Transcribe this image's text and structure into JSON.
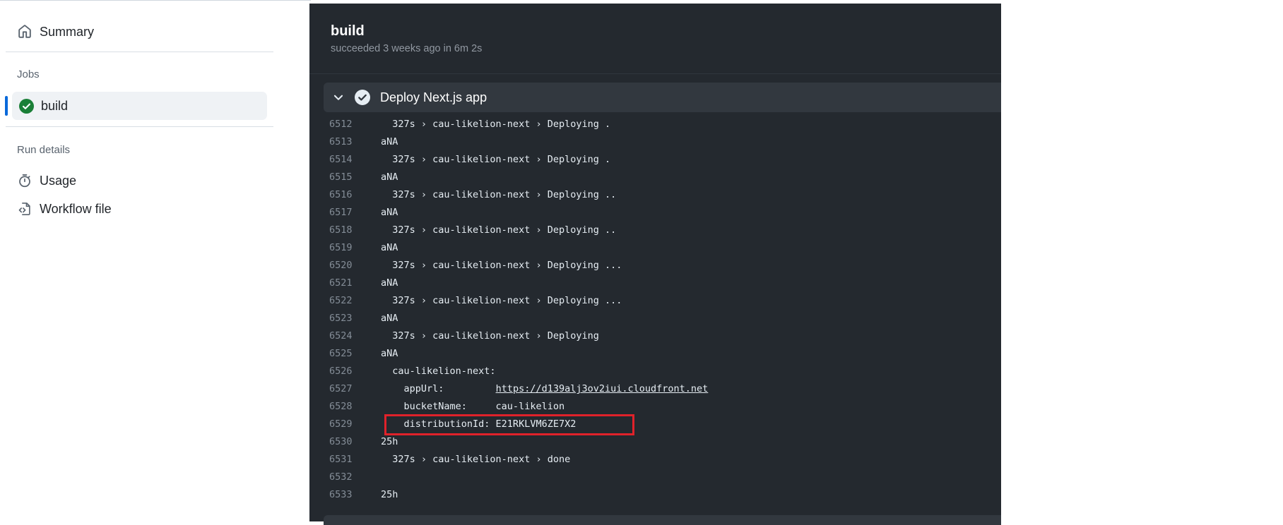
{
  "sidebar": {
    "summary_label": "Summary",
    "jobs_heading": "Jobs",
    "job_item_label": "build",
    "run_details_heading": "Run details",
    "usage_label": "Usage",
    "workflow_file_label": "Workflow file"
  },
  "job": {
    "title": "build",
    "meta": "succeeded 3 weeks ago in 6m 2s"
  },
  "step": {
    "name": "Deploy Next.js app"
  },
  "log": {
    "lines": [
      {
        "num": "6512",
        "text": "  327s › cau-likelion-next › Deploying ."
      },
      {
        "num": "6513",
        "text": "aNA"
      },
      {
        "num": "6514",
        "text": "  327s › cau-likelion-next › Deploying ."
      },
      {
        "num": "6515",
        "text": "aNA"
      },
      {
        "num": "6516",
        "text": "  327s › cau-likelion-next › Deploying .."
      },
      {
        "num": "6517",
        "text": "aNA"
      },
      {
        "num": "6518",
        "text": "  327s › cau-likelion-next › Deploying .."
      },
      {
        "num": "6519",
        "text": "aNA"
      },
      {
        "num": "6520",
        "text": "  327s › cau-likelion-next › Deploying ..."
      },
      {
        "num": "6521",
        "text": "aNA"
      },
      {
        "num": "6522",
        "text": "  327s › cau-likelion-next › Deploying ..."
      },
      {
        "num": "6523",
        "text": "aNA"
      },
      {
        "num": "6524",
        "text": "  327s › cau-likelion-next › Deploying"
      },
      {
        "num": "6525",
        "text": "aNA"
      },
      {
        "num": "6526",
        "text": "  cau-likelion-next:"
      },
      {
        "num": "6527",
        "text": "    appUrl:         ",
        "link": "https://d139alj3ov2iui.cloudfront.net"
      },
      {
        "num": "6528",
        "text": "    bucketName:     cau-likelion"
      },
      {
        "num": "6529",
        "text": "    distributionId: E21RKLVM6ZE7X2"
      },
      {
        "num": "6530",
        "text": "25h"
      },
      {
        "num": "6531",
        "text": "  327s › cau-likelion-next › done"
      },
      {
        "num": "6532",
        "text": ""
      },
      {
        "num": "6533",
        "text": "25h"
      }
    ]
  },
  "colors": {
    "accent": "#0969da",
    "success": "#1a7f37",
    "panel_bg": "#24292f",
    "highlight_border": "#e0222a"
  },
  "icons": {
    "summary": "home-icon",
    "job_status": "check-circle-icon",
    "usage": "stopwatch-icon",
    "workflow_file": "file-code-icon",
    "step_toggle": "chevron-down-icon",
    "step_status": "check-circle-icon"
  }
}
